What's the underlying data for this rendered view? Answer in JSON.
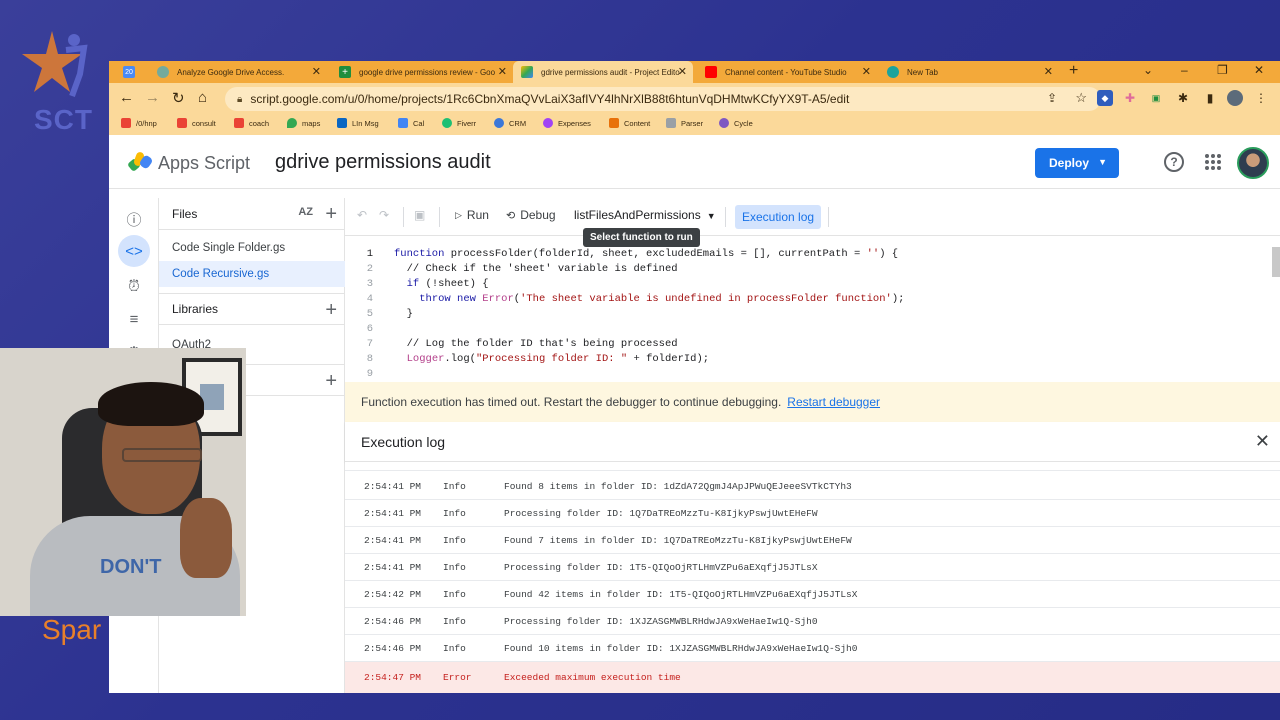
{
  "overlay": {
    "logo_text": "SCT",
    "bottom_text": "Spar"
  },
  "browser": {
    "tabs": [
      {
        "label": "Analyze Google Drive Access.",
        "icon": "chatgpt-icon",
        "color": "#74aa9c"
      },
      {
        "label": "google drive permissions review - Goo",
        "icon": "sheets-icon",
        "color": "#1e8e3e"
      },
      {
        "label": "gdrive permissions audit - Project Edito",
        "icon": "apps-script-icon",
        "color": "#4285f4"
      },
      {
        "label": "Channel content - YouTube Studio",
        "icon": "youtube-icon",
        "color": "#ff0000"
      },
      {
        "label": "New Tab",
        "icon": "new-tab-icon",
        "color": "#1ca39c"
      }
    ],
    "first_tab_badge": "20",
    "address": "script.google.com/u/0/home/projects/1Rc6CbnXmaQVvLaiX3afIVY4lhNrXlB88t6htunVqDHMtwKCfyYX9T-A5/edit",
    "bookmarks": [
      {
        "label": "/0/hnp",
        "icon": "gmail-icon"
      },
      {
        "label": "consult",
        "icon": "gmail-icon"
      },
      {
        "label": "coach",
        "icon": "gmail-icon"
      },
      {
        "label": "maps",
        "icon": "maps-icon"
      },
      {
        "label": "LIn Msg",
        "icon": "linkedin-icon"
      },
      {
        "label": "Cal",
        "icon": "calendar-icon"
      },
      {
        "label": "Fiverr",
        "icon": "fiverr-icon"
      },
      {
        "label": "CRM",
        "icon": "crm-icon"
      },
      {
        "label": "Expenses",
        "icon": "expenses-icon"
      },
      {
        "label": "Content",
        "icon": "content-icon"
      },
      {
        "label": "Parser",
        "icon": "parser-icon"
      },
      {
        "label": "Cycle",
        "icon": "cycle-icon"
      }
    ]
  },
  "app": {
    "product": "Apps Script",
    "project": "gdrive permissions audit",
    "deploy_label": "Deploy"
  },
  "files": {
    "header": "Files",
    "sort_label": "AZ",
    "items": [
      "Code Single Folder.gs",
      "Code Recursive.gs"
    ],
    "libraries_header": "Libraries",
    "library_items": [
      "OAuth2"
    ]
  },
  "toolbar": {
    "run": "Run",
    "debug": "Debug",
    "function_name": "listFilesAndPermissions",
    "execution_log": "Execution log",
    "tooltip": "Select function to run"
  },
  "code_lines": [
    {
      "n": "1",
      "text": "function processFolder(folderId, sheet, excludedEmails = [], currentPath = '') {"
    },
    {
      "n": "2",
      "text": "  // Check if the 'sheet' variable is defined"
    },
    {
      "n": "3",
      "text": "  if (!sheet) {"
    },
    {
      "n": "4",
      "text": "    throw new Error('The sheet variable is undefined in processFolder function');"
    },
    {
      "n": "5",
      "text": "  }"
    },
    {
      "n": "6",
      "text": ""
    },
    {
      "n": "7",
      "text": "  // Log the folder ID that's being processed"
    },
    {
      "n": "8",
      "text": "  Logger.log(\"Processing folder ID: \" + folderId);"
    },
    {
      "n": "9",
      "text": ""
    }
  ],
  "banner": {
    "message": "Function execution has timed out. Restart the debugger to continue debugging.",
    "link": "Restart debugger"
  },
  "log": {
    "title": "Execution log",
    "rows": [
      {
        "time": "2:54:41 PM",
        "level": "Info",
        "message": "Found 8 items in folder ID: 1dZdA72QgmJ4ApJPWuQEJeeeSVTkCTYh3"
      },
      {
        "time": "2:54:41 PM",
        "level": "Info",
        "message": "Processing folder ID: 1Q7DaTREoMzzTu-K8IjkyPswjUwtEHeFW"
      },
      {
        "time": "2:54:41 PM",
        "level": "Info",
        "message": "Found 7 items in folder ID: 1Q7DaTREoMzzTu-K8IjkyPswjUwtEHeFW"
      },
      {
        "time": "2:54:41 PM",
        "level": "Info",
        "message": "Processing folder ID: 1T5-QIQoOjRTLHmVZPu6aEXqfjJ5JTLsX"
      },
      {
        "time": "2:54:42 PM",
        "level": "Info",
        "message": "Found 42 items in folder ID: 1T5-QIQoOjRTLHmVZPu6aEXqfjJ5JTLsX"
      },
      {
        "time": "2:54:46 PM",
        "level": "Info",
        "message": "Processing folder ID: 1XJZASGMWBLRHdwJA9xWeHaeIw1Q-Sjh0"
      },
      {
        "time": "2:54:46 PM",
        "level": "Info",
        "message": "Found 10 items in folder ID: 1XJZASGMWBLRHdwJA9xWeHaeIw1Q-Sjh0"
      },
      {
        "time": "2:54:47 PM",
        "level": "Error",
        "message": "Exceeded maximum execution time"
      }
    ]
  },
  "webcam": {
    "shirt_text": "DON'T"
  }
}
